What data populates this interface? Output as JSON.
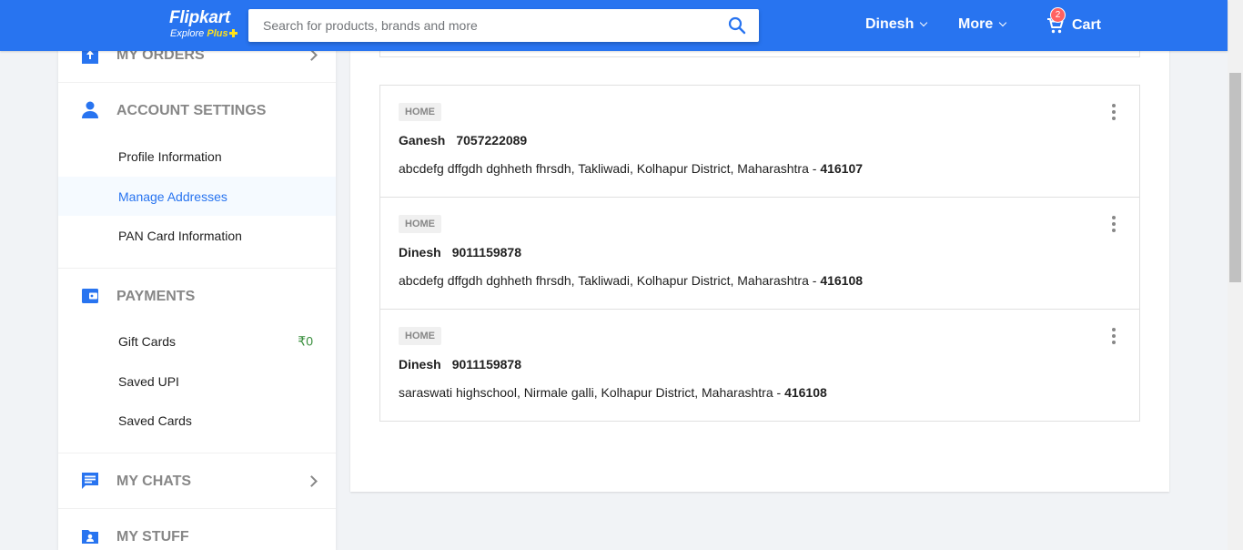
{
  "header": {
    "logo_text": "Flipkart",
    "logo_sub_explore": "Explore",
    "logo_sub_plus": "Plus",
    "search_placeholder": "Search for products, brands and more",
    "user_label": "Dinesh",
    "more_label": "More",
    "cart_label": "Cart",
    "cart_count": "2",
    "brand_color": "#2874f0"
  },
  "sidebar": {
    "my_orders": {
      "label": "MY ORDERS",
      "icon": "orders-icon"
    },
    "account_settings": {
      "label": "ACCOUNT SETTINGS",
      "icon": "person-icon",
      "items": [
        {
          "label": "Profile Information"
        },
        {
          "label": "Manage Addresses",
          "active": true
        },
        {
          "label": "PAN Card Information"
        }
      ]
    },
    "payments": {
      "label": "PAYMENTS",
      "icon": "wallet-icon",
      "items": [
        {
          "label": "Gift Cards",
          "value": "₹0"
        },
        {
          "label": "Saved UPI"
        },
        {
          "label": "Saved Cards"
        }
      ]
    },
    "my_chats": {
      "label": "MY CHATS",
      "icon": "chat-icon"
    },
    "my_stuff": {
      "label": "MY STUFF",
      "icon": "folder-user-icon"
    }
  },
  "addresses": [
    {
      "tag": "HOME",
      "name": "Ganesh",
      "phone": "7057222089",
      "address": "abcdefg dffgdh dghheth fhrsdh, Takliwadi, Kolhapur District, Maharashtra - ",
      "pincode": "416107"
    },
    {
      "tag": "HOME",
      "name": "Dinesh",
      "phone": "9011159878",
      "address": "abcdefg dffgdh dghheth fhrsdh, Takliwadi, Kolhapur District, Maharashtra - ",
      "pincode": "416108"
    },
    {
      "tag": "HOME",
      "name": "Dinesh",
      "phone": "9011159878",
      "address": "saraswati highschool, Nirmale galli, Kolhapur District, Maharashtra - ",
      "pincode": "416108"
    }
  ]
}
